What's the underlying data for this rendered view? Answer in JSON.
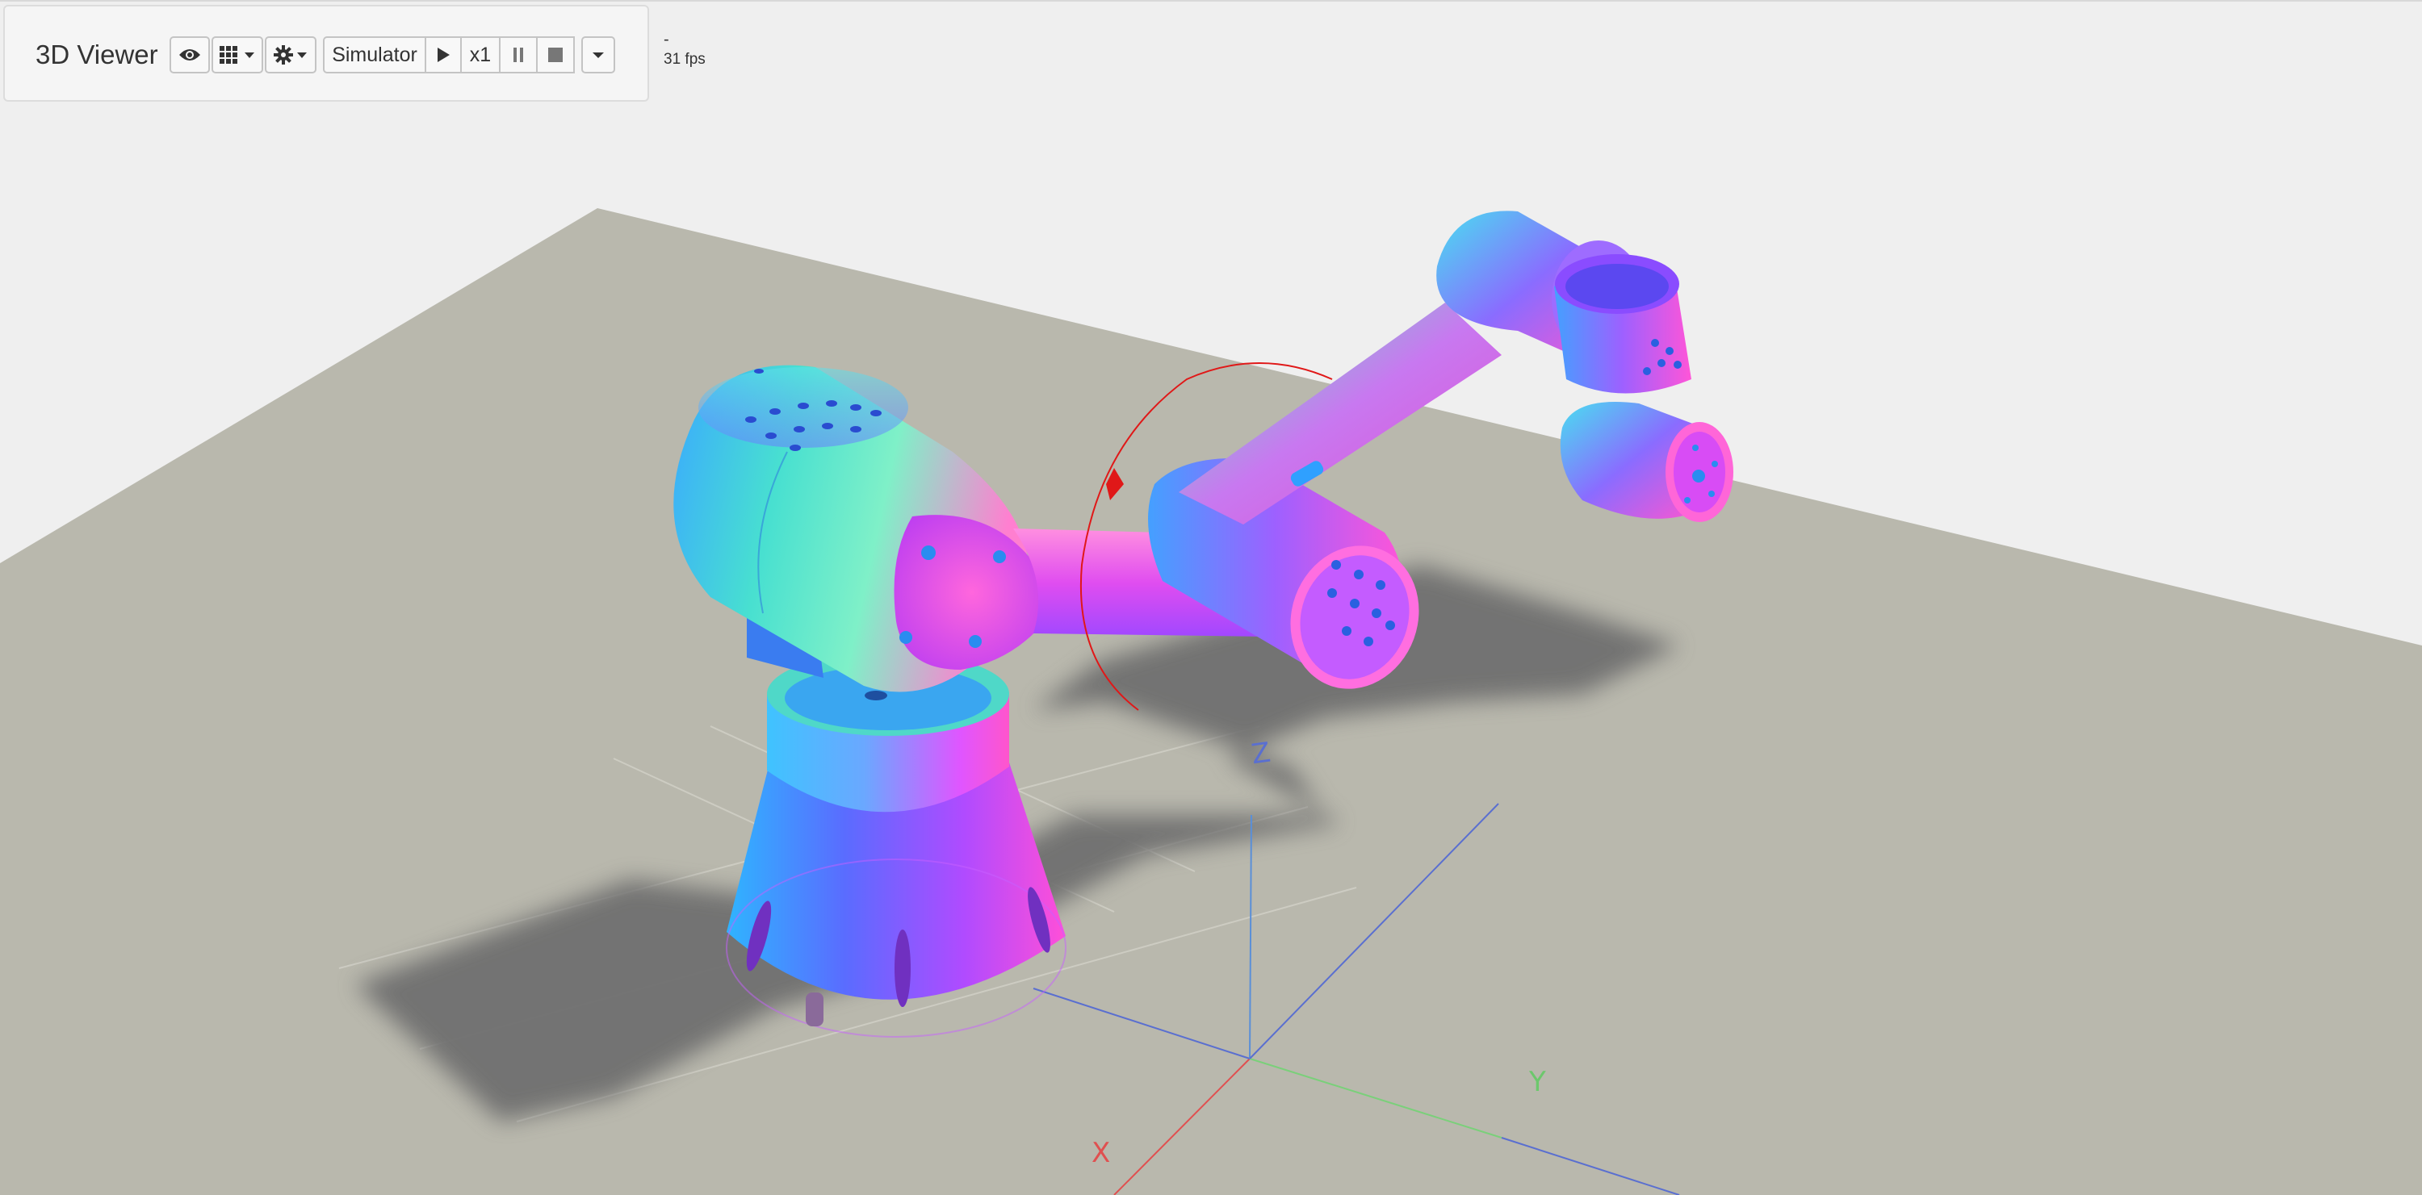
{
  "app": {
    "title": "3D Viewer"
  },
  "toolbar": {
    "view_icon": "eye-icon",
    "grid_icon": "grid-icon",
    "settings_icon": "gear-icon",
    "simulator_label": "Simulator",
    "play_icon": "play-icon",
    "speed_label": "x1",
    "pause_icon": "pause-icon",
    "stop_icon": "stop-icon",
    "more_icon": "caret-down-icon"
  },
  "status": {
    "dash": "-",
    "fps": "31 fps"
  },
  "scene": {
    "axis_labels": {
      "x": "X",
      "y": "Y",
      "z": "Z"
    },
    "colors": {
      "background": "#efefef",
      "ground": "#b9b8ad",
      "shadow": "#6f6f6f",
      "x_axis": "#e05050",
      "y_axis": "#7ad07a",
      "z_axis": "#5a8fd8",
      "gizmo_ring": "#e01818"
    }
  }
}
